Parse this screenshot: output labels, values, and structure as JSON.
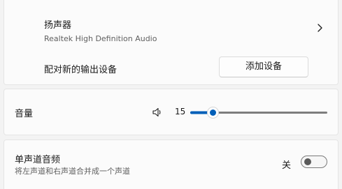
{
  "output_device": {
    "name": "扬声器",
    "description": "Realtek High Definition Audio",
    "icon": "chevron-right-icon"
  },
  "pair": {
    "label": "配对新的输出设备",
    "button_label": "添加设备"
  },
  "volume": {
    "label": "音量",
    "value": "15",
    "level_percent": 15,
    "icon": "speaker-icon",
    "accent_color": "#005fb8"
  },
  "mono_audio": {
    "title": "单声道音频",
    "description": "将左声道和右声道合并成一个声道",
    "toggle_state_label": "关",
    "toggle_on": false
  }
}
